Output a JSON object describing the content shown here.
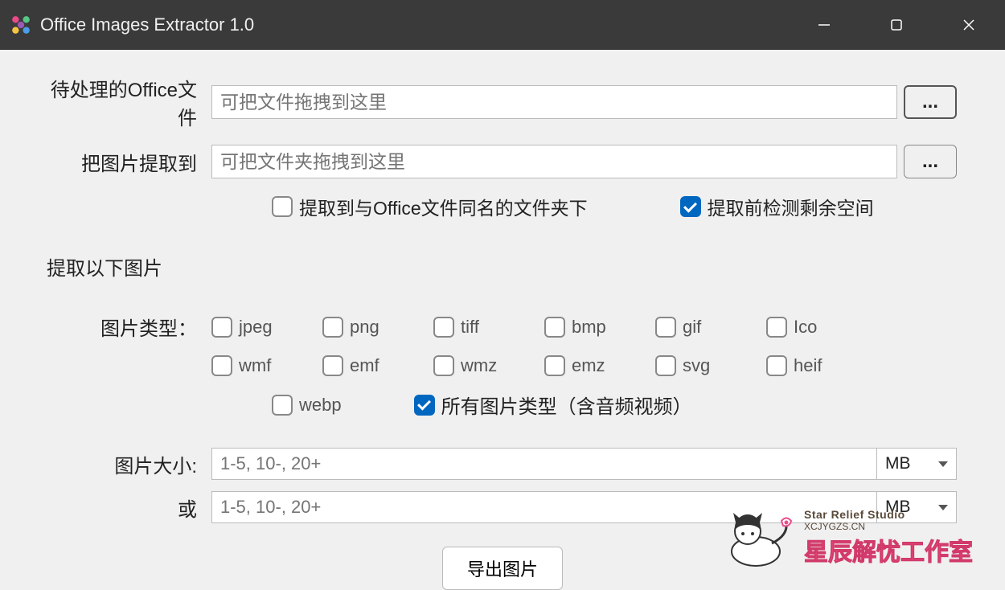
{
  "window": {
    "title": "Office Images Extractor 1.0"
  },
  "labels": {
    "input_file": "待处理的Office文件",
    "output_dir": "把图片提取到",
    "browse": "...",
    "same_name_folder": "提取到与Office文件同名的文件夹下",
    "check_space": "提取前检测剩余空间",
    "extract_section": "提取以下图片",
    "image_type": "图片类型：",
    "all_types": "所有图片类型（含音频视频）",
    "image_size": "图片大小:",
    "or": "或",
    "action": "导出图片"
  },
  "placeholders": {
    "input_file": "可把文件拖拽到这里",
    "output_dir": "可把文件夹拖拽到这里",
    "size_expr": "1-5, 10-, 20+"
  },
  "checkboxes": {
    "same_name_folder": false,
    "check_space": true,
    "all_types": true
  },
  "image_types": [
    {
      "name": "jpeg",
      "checked": false
    },
    {
      "name": "png",
      "checked": false
    },
    {
      "name": "tiff",
      "checked": false
    },
    {
      "name": "bmp",
      "checked": false
    },
    {
      "name": "gif",
      "checked": false
    },
    {
      "name": "Ico",
      "checked": false
    },
    {
      "name": "wmf",
      "checked": false
    },
    {
      "name": "emf",
      "checked": false
    },
    {
      "name": "wmz",
      "checked": false
    },
    {
      "name": "emz",
      "checked": false
    },
    {
      "name": "svg",
      "checked": false
    },
    {
      "name": "heif",
      "checked": false
    },
    {
      "name": "webp",
      "checked": false
    }
  ],
  "size_unit": "MB",
  "size_value_1": "1-5, 10-, 20+",
  "size_value_2": "1-5, 10-, 20+",
  "watermark": {
    "en": "Star Relief Studio",
    "url": "XCJYGZS.CN",
    "cn": "星辰解忧工作室"
  }
}
